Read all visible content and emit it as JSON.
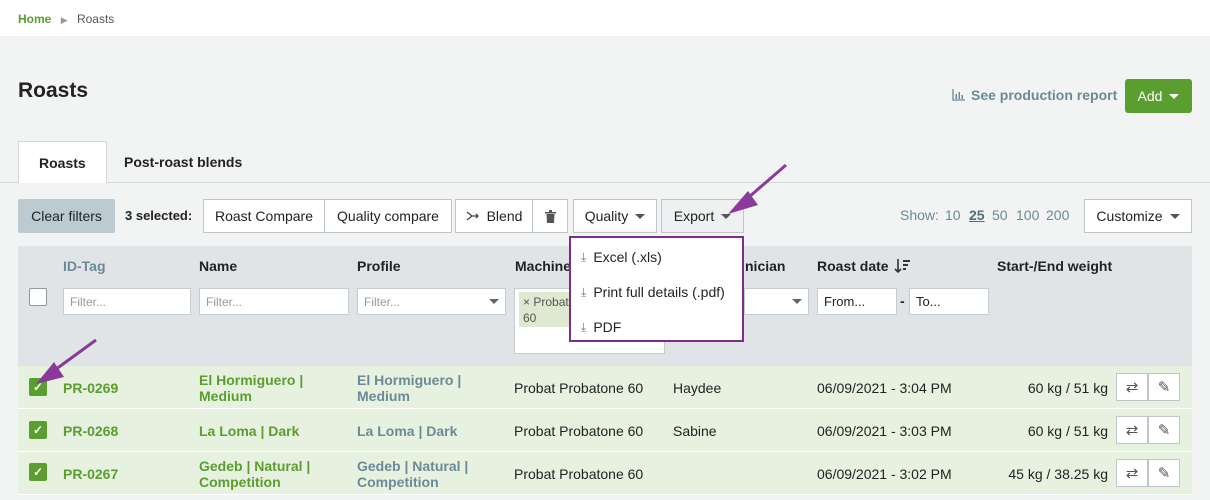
{
  "breadcrumb": {
    "home": "Home",
    "current": "Roasts"
  },
  "page": {
    "title": "Roasts"
  },
  "header": {
    "report_link": "See production report",
    "add_label": "Add"
  },
  "tabs": [
    {
      "label": "Roasts"
    },
    {
      "label": "Post-roast blends"
    }
  ],
  "toolbar": {
    "clear_filters": "Clear filters",
    "selected": "3 selected:",
    "roast_compare": "Roast Compare",
    "quality_compare": "Quality compare",
    "blend": "Blend",
    "quality": "Quality",
    "export": "Export",
    "show_label": "Show:",
    "show_options": [
      "10",
      "25",
      "50",
      "100",
      "200"
    ],
    "show_selected": "25",
    "customize": "Customize"
  },
  "export_menu": [
    {
      "label": "Excel (.xls)"
    },
    {
      "label": "Print full details (.pdf)"
    },
    {
      "label": "PDF"
    }
  ],
  "table": {
    "columns": {
      "id": "ID-Tag",
      "name": "Name",
      "profile": "Profile",
      "machine": "Machine",
      "technician": "nician",
      "roast_date": "Roast date",
      "weight": "Start-/End weight"
    },
    "filters": {
      "filter": "Filter...",
      "from": "From...",
      "to": "To...",
      "machine_tag_1": "Probat",
      "machine_tag_2": "60",
      "machine_tag_x": "×"
    },
    "rows": [
      {
        "id": "PR-0269",
        "name_1": "El Hormiguero |",
        "name_2": "Medium",
        "profile_1": "El Hormiguero |",
        "profile_2": "Medium",
        "machine": "Probat Probatone 60",
        "tech": "Haydee",
        "date": "06/09/2021 - 3:04 PM",
        "weight": "60 kg / 51 kg"
      },
      {
        "id": "PR-0268",
        "name_1": "La Loma | Dark",
        "name_2": "",
        "profile_1": "La Loma | Dark",
        "profile_2": "",
        "machine": "Probat Probatone 60",
        "tech": "Sabine",
        "date": "06/09/2021 - 3:03 PM",
        "weight": "60 kg / 51 kg"
      },
      {
        "id": "PR-0267",
        "name_1": "Gedeb | Natural |",
        "name_2": "Competition",
        "profile_1": "Gedeb | Natural |",
        "profile_2": "Competition",
        "machine": "Probat Probatone 60",
        "tech": "",
        "date": "06/09/2021 - 3:02 PM",
        "weight": "45 kg / 38.25 kg"
      }
    ]
  },
  "colors": {
    "accent": "#5a9e2f",
    "highlight": "#7b2d8b",
    "row_selected": "#e7f1e0"
  }
}
